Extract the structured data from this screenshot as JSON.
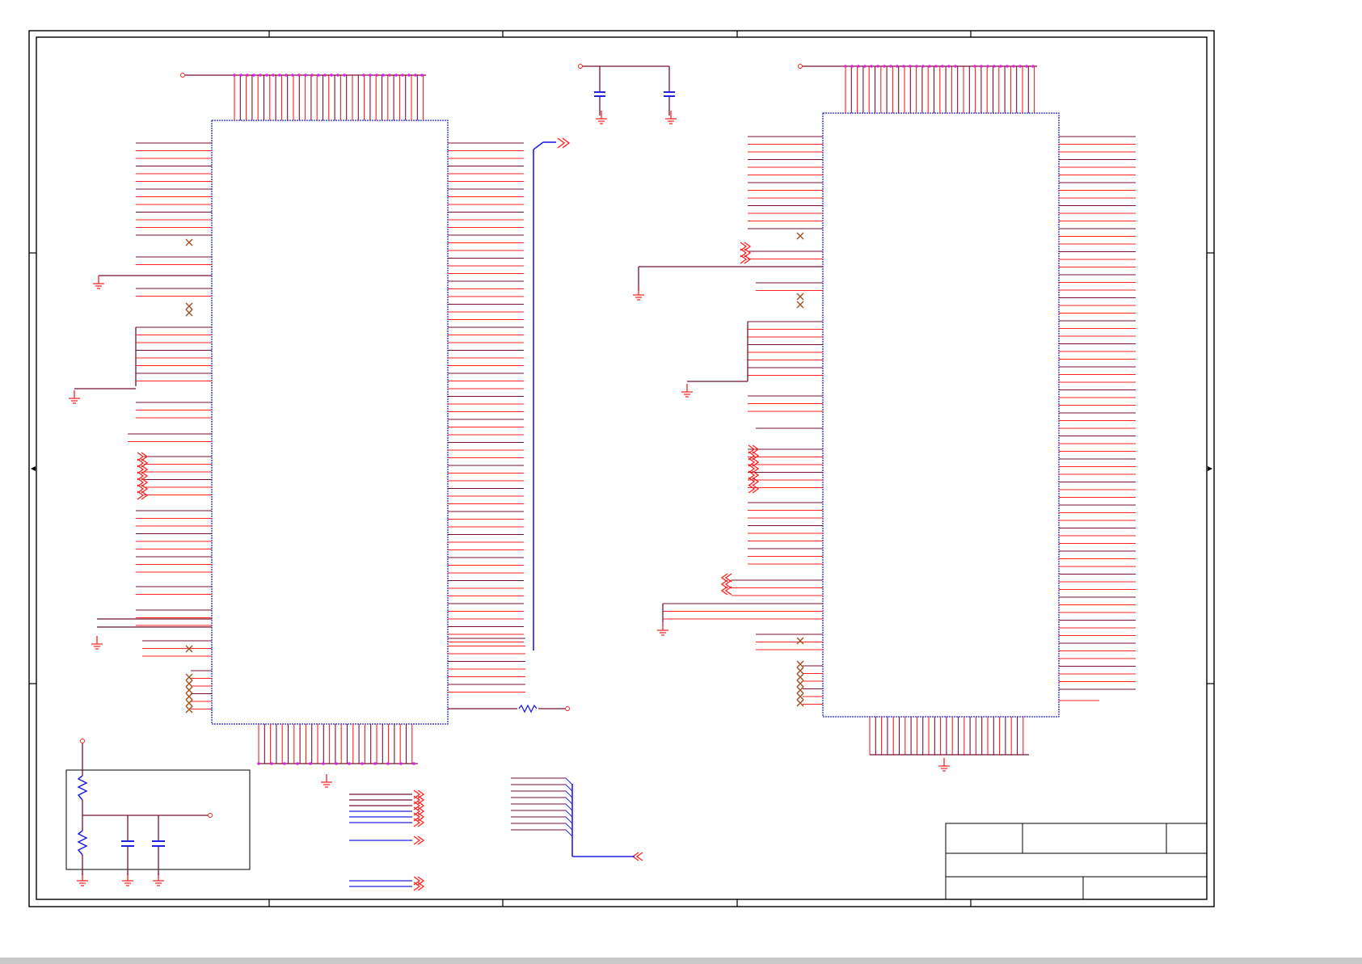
{
  "palette": {
    "wire_red": "#ff2020",
    "wire_dark": "#7a1030",
    "bus_blue": "#2020e0",
    "junction": "#e020e0",
    "no_connect": "#a05020",
    "frame": "#000000",
    "bottom_band": "#c8c8c8"
  },
  "icons": {
    "ground": "ground-icon",
    "no_connect": "no-connect-x-icon",
    "off_page": "off-page-connector-icon",
    "resistor": "resistor-icon",
    "capacitor": "capacitor-icon"
  },
  "schematic": {
    "chips": [
      {
        "id": "left-ic",
        "label": ""
      },
      {
        "id": "right-ic",
        "label": ""
      }
    ],
    "title_block": {
      "title": "",
      "document_number": "",
      "revision": "",
      "sheet": "",
      "date": ""
    }
  }
}
